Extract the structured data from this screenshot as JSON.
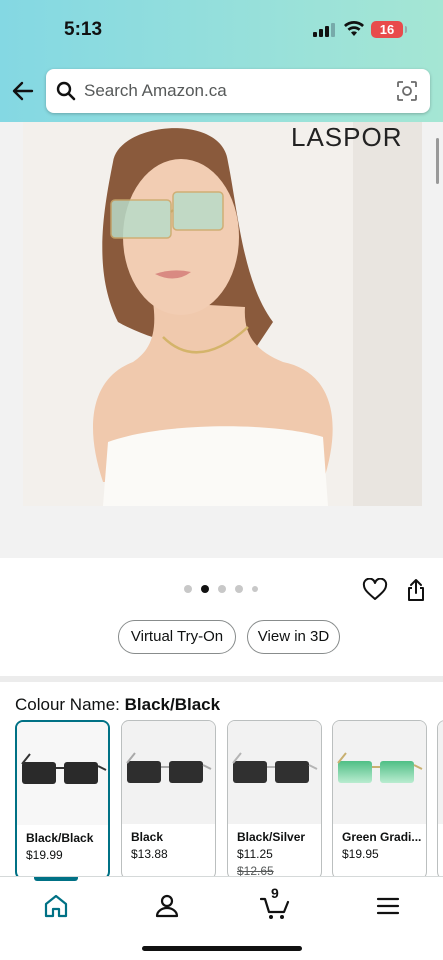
{
  "status_bar": {
    "time": "5:13",
    "battery": "16"
  },
  "search": {
    "placeholder": "Search Amazon.ca"
  },
  "hero": {
    "brand": "LASPOR"
  },
  "carousel": {
    "count": 5,
    "active_index": 1
  },
  "buttons": {
    "virtual_try_on": "Virtual Try-On",
    "view_in_3d": "View in 3D"
  },
  "colour": {
    "label": "Colour Name:",
    "value": "Black/Black"
  },
  "swatches": [
    {
      "name": "Black/Black",
      "price": "$19.99",
      "old_price": "",
      "lens": "#2a2a2a",
      "frame": "#333333"
    },
    {
      "name": "Black",
      "price": "$13.88",
      "old_price": "",
      "lens": "#2e2e2e",
      "frame": "#a9a9a9"
    },
    {
      "name": "Black/Silver",
      "price": "$11.25",
      "old_price": "$12.65",
      "lens": "#303030",
      "frame": "#b5b5b5"
    },
    {
      "name": "Green Gradi...",
      "price": "$19.95",
      "old_price": "",
      "lens": "#6fd19a",
      "frame": "#c8b070"
    }
  ],
  "tabbar": {
    "cart_count": "9"
  },
  "colors": {
    "accent": "#007185",
    "header_start": "#84d8e3",
    "header_end": "#a5e6d4"
  }
}
